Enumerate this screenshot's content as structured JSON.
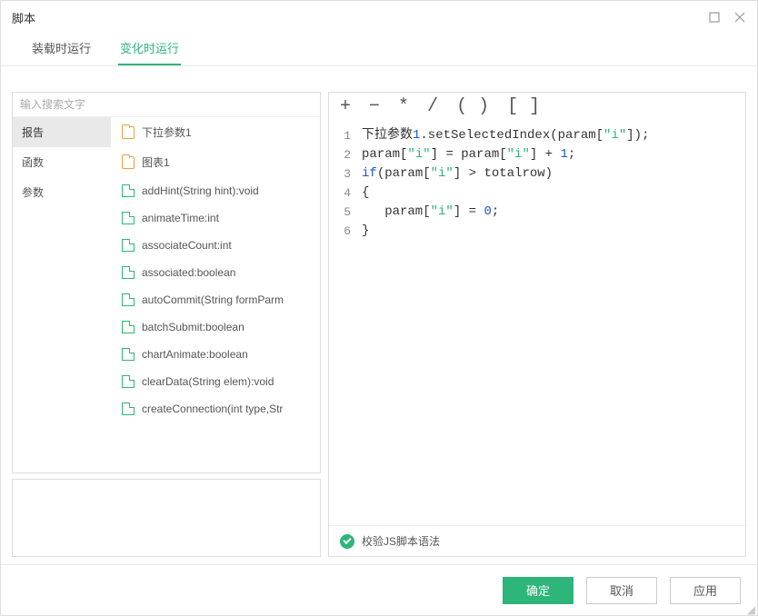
{
  "window": {
    "title": "脚本"
  },
  "tabs": [
    {
      "label": "装载时运行",
      "active": false
    },
    {
      "label": "变化时运行",
      "active": true
    }
  ],
  "search": {
    "placeholder": "输入搜索文字"
  },
  "categories": [
    {
      "label": "报告",
      "active": true
    },
    {
      "label": "函数",
      "active": false
    },
    {
      "label": "参数",
      "active": false
    }
  ],
  "items": [
    {
      "kind": "folder",
      "label": "下拉参数1"
    },
    {
      "kind": "folder",
      "label": "图表1"
    },
    {
      "kind": "file",
      "label": "addHint(String hint):void"
    },
    {
      "kind": "file",
      "label": "animateTime:int"
    },
    {
      "kind": "file",
      "label": "associateCount:int"
    },
    {
      "kind": "file",
      "label": "associated:boolean"
    },
    {
      "kind": "file",
      "label": "autoCommit(String formParm"
    },
    {
      "kind": "file",
      "label": "batchSubmit:boolean"
    },
    {
      "kind": "file",
      "label": "chartAnimate:boolean"
    },
    {
      "kind": "file",
      "label": "clearData(String elem):void"
    },
    {
      "kind": "file",
      "label": "createConnection(int type,Str"
    }
  ],
  "operators": [
    "+",
    "−",
    "*",
    "/",
    "( )",
    "[ ]"
  ],
  "code_lines": [
    {
      "n": 1,
      "tokens": [
        {
          "t": "下拉参数",
          "c": "s-ident"
        },
        {
          "t": "1",
          "c": "s-num"
        },
        {
          "t": ".setSelectedIndex(param[",
          "c": "s-ident"
        },
        {
          "t": "\"i\"",
          "c": "s-str"
        },
        {
          "t": "]);",
          "c": "s-ident"
        }
      ]
    },
    {
      "n": 2,
      "tokens": [
        {
          "t": "param[",
          "c": "s-ident"
        },
        {
          "t": "\"i\"",
          "c": "s-str"
        },
        {
          "t": "] = param[",
          "c": "s-ident"
        },
        {
          "t": "\"i\"",
          "c": "s-str"
        },
        {
          "t": "] + ",
          "c": "s-ident"
        },
        {
          "t": "1",
          "c": "s-num"
        },
        {
          "t": ";",
          "c": "s-ident"
        }
      ]
    },
    {
      "n": 3,
      "tokens": [
        {
          "t": "if",
          "c": "s-key"
        },
        {
          "t": "(param[",
          "c": "s-ident"
        },
        {
          "t": "\"i\"",
          "c": "s-str"
        },
        {
          "t": "] > totalrow)",
          "c": "s-ident"
        }
      ]
    },
    {
      "n": 4,
      "tokens": [
        {
          "t": "{",
          "c": "s-ident"
        }
      ]
    },
    {
      "n": 5,
      "tokens": [
        {
          "t": "   param[",
          "c": "s-ident"
        },
        {
          "t": "\"i\"",
          "c": "s-str"
        },
        {
          "t": "] = ",
          "c": "s-ident"
        },
        {
          "t": "0",
          "c": "s-num"
        },
        {
          "t": ";",
          "c": "s-ident"
        }
      ]
    },
    {
      "n": 6,
      "tokens": [
        {
          "t": "}",
          "c": "s-ident"
        }
      ]
    }
  ],
  "validate": {
    "label": "校验JS脚本语法"
  },
  "footer": {
    "ok": "确定",
    "cancel": "取消",
    "apply": "应用"
  }
}
